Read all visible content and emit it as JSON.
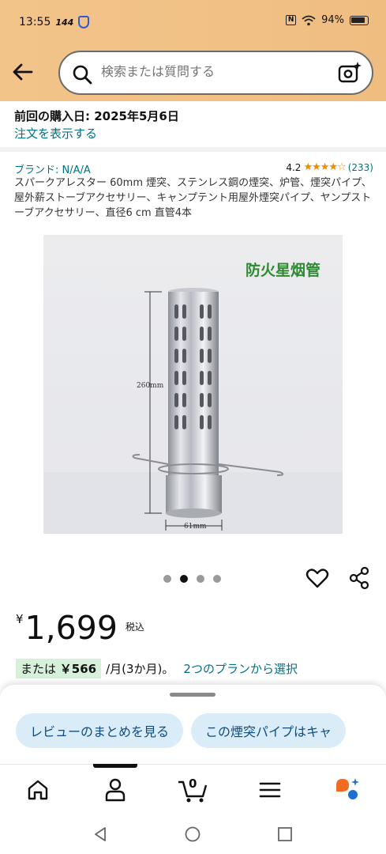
{
  "status_bar": {
    "time": "13:55",
    "speed": "144",
    "battery": "94%"
  },
  "search": {
    "placeholder": "検索または質問する"
  },
  "purchase": {
    "line": "前回の購入日: 2025年5月6日",
    "link": "注文を表示する"
  },
  "product": {
    "brand": "ブランド: N/A/A",
    "rating": "4.2",
    "stars": "★★★★☆",
    "review_count": "(233)",
    "title": "スパークアレスター 60mm 煙突、ステンレス鋼の煙突、炉管、煙突パイプ、屋外薪ストーブアクセサリー、キャンプテント用屋外煙突パイプ、ヤンプストーブアクセサリー、直径6 cm 直管4本",
    "image": {
      "caption": "防火星烟管",
      "dim_height": "260mm",
      "dim_diameter": "61mm"
    },
    "carousel": {
      "count": 4,
      "active": 2
    }
  },
  "price": {
    "currency": "¥",
    "value": "1,699",
    "tax": "税込"
  },
  "installment": {
    "prefix": "または",
    "amount": "￥566",
    "period": "/月(3か月)。",
    "link": "2つのプランから選択"
  },
  "chips": [
    "レビューのまとめを見る",
    "この煙突パイプはキャ"
  ],
  "nav": {
    "cart_count": "0",
    "items": [
      "home-icon",
      "account-icon",
      "cart-icon",
      "menu-icon",
      "rufus-icon"
    ]
  },
  "colors": {
    "header": "#f1c186",
    "link": "#007185",
    "star": "#f08a00",
    "chip_bg": "#d9ecf7",
    "badge_bg": "#d6f0d9"
  }
}
